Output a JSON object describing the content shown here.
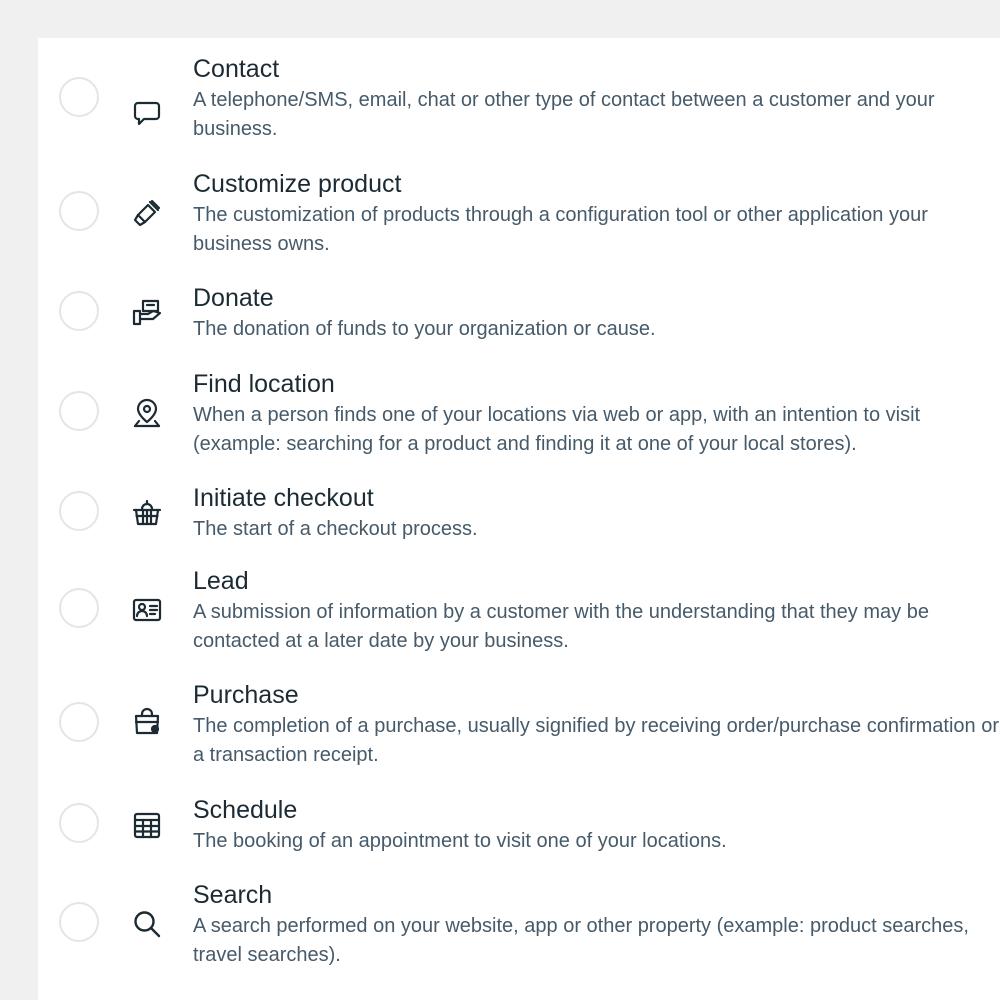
{
  "options": [
    {
      "title": "Contact",
      "description": "A telephone/SMS, email, chat or other type of contact between a customer and your business.",
      "icon": "chat-bubble-icon"
    },
    {
      "title": "Customize product",
      "description": "The customization of products through a configuration tool or other application your business owns.",
      "icon": "paintbrush-icon"
    },
    {
      "title": "Donate",
      "description": "The donation of funds to your organization or cause.",
      "icon": "donate-icon"
    },
    {
      "title": "Find location",
      "description": "When a person finds one of your locations via web or app, with an intention to visit (example: searching for a product and finding it at one of your local stores).",
      "icon": "location-pin-icon"
    },
    {
      "title": "Initiate checkout",
      "description": "The start of a checkout process.",
      "icon": "basket-icon"
    },
    {
      "title": "Lead",
      "description": "A submission of information by a customer with the understanding that they may be contacted at a later date by your business.",
      "icon": "id-card-icon"
    },
    {
      "title": "Purchase",
      "description": "The completion of a purchase, usually signified by receiving order/purchase confirmation or a transaction receipt.",
      "icon": "shopping-bag-icon"
    },
    {
      "title": "Schedule",
      "description": "The booking of an appointment to visit one of your locations.",
      "icon": "calendar-icon"
    },
    {
      "title": "Search",
      "description": "A search performed on your website, app or other property (example: product searches, travel searches).",
      "icon": "search-icon"
    }
  ],
  "colors": {
    "background": "#f0f0f0",
    "panel": "#ffffff",
    "title": "#1c2b33",
    "description": "#465a69",
    "radio_border": "#e3e5e8"
  }
}
